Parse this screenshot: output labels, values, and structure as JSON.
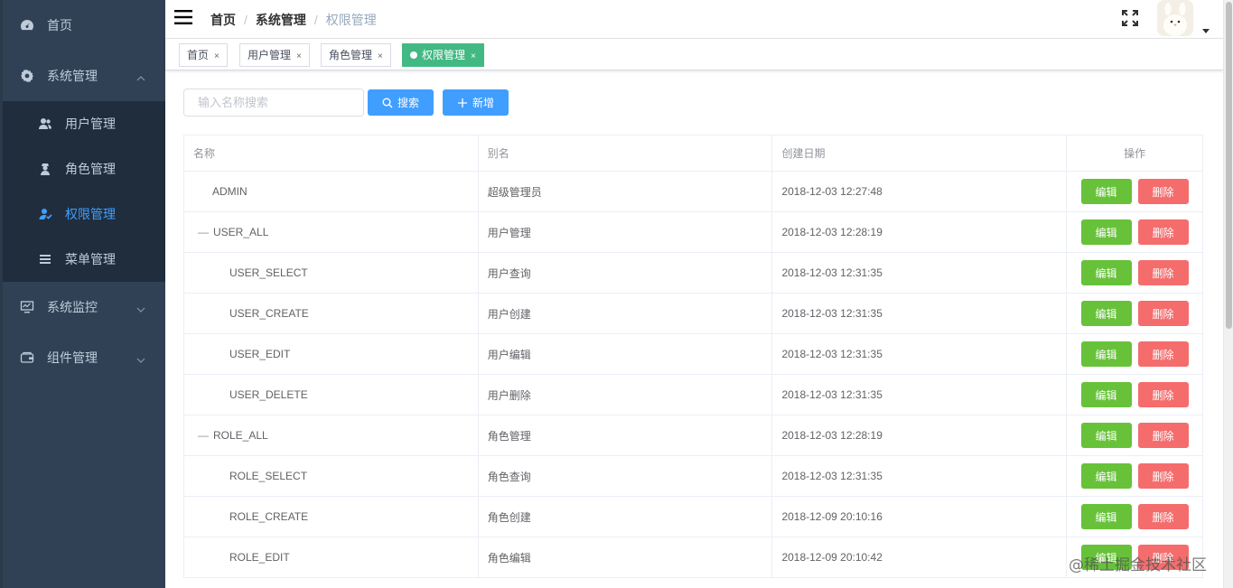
{
  "sidebar": {
    "items": [
      {
        "label": "首页",
        "icon": "dashboard-icon"
      },
      {
        "label": "系统管理",
        "icon": "gear-icon",
        "expanded": true,
        "children": [
          {
            "label": "用户管理",
            "icon": "user-icon"
          },
          {
            "label": "角色管理",
            "icon": "role-icon"
          },
          {
            "label": "权限管理",
            "icon": "permission-icon",
            "active": true
          },
          {
            "label": "菜单管理",
            "icon": "menu-icon"
          }
        ]
      },
      {
        "label": "系统监控",
        "icon": "monitor-icon"
      },
      {
        "label": "组件管理",
        "icon": "component-icon"
      }
    ]
  },
  "navbar": {
    "breadcrumb": [
      "首页",
      "系统管理",
      "权限管理"
    ]
  },
  "tags": [
    {
      "label": "首页"
    },
    {
      "label": "用户管理"
    },
    {
      "label": "角色管理"
    },
    {
      "label": "权限管理",
      "active": true
    }
  ],
  "toolbar": {
    "search_placeholder": "输入名称搜索",
    "search_label": "搜索",
    "add_label": "新增"
  },
  "table": {
    "columns": [
      "名称",
      "别名",
      "创建日期",
      "操作"
    ],
    "edit_label": "编辑",
    "delete_label": "删除",
    "rows": [
      {
        "name": "ADMIN",
        "alias": "超级管理员",
        "date": "2018-12-03 12:27:48",
        "level": 0,
        "expandable": false
      },
      {
        "name": "USER_ALL",
        "alias": "用户管理",
        "date": "2018-12-03 12:28:19",
        "level": 0,
        "expandable": true
      },
      {
        "name": "USER_SELECT",
        "alias": "用户查询",
        "date": "2018-12-03 12:31:35",
        "level": 1,
        "expandable": false
      },
      {
        "name": "USER_CREATE",
        "alias": "用户创建",
        "date": "2018-12-03 12:31:35",
        "level": 1,
        "expandable": false
      },
      {
        "name": "USER_EDIT",
        "alias": "用户编辑",
        "date": "2018-12-03 12:31:35",
        "level": 1,
        "expandable": false
      },
      {
        "name": "USER_DELETE",
        "alias": "用户删除",
        "date": "2018-12-03 12:31:35",
        "level": 1,
        "expandable": false
      },
      {
        "name": "ROLE_ALL",
        "alias": "角色管理",
        "date": "2018-12-03 12:28:19",
        "level": 0,
        "expandable": true
      },
      {
        "name": "ROLE_SELECT",
        "alias": "角色查询",
        "date": "2018-12-03 12:31:35",
        "level": 1,
        "expandable": false
      },
      {
        "name": "ROLE_CREATE",
        "alias": "角色创建",
        "date": "2018-12-09 20:10:16",
        "level": 1,
        "expandable": false
      },
      {
        "name": "ROLE_EDIT",
        "alias": "角色编辑",
        "date": "2018-12-09 20:10:42",
        "level": 1,
        "expandable": false
      }
    ]
  },
  "watermark": "@稀土掘金技术社区",
  "colors": {
    "sidebar_bg": "#304156",
    "submenu_bg": "#1f2d3d",
    "active_text": "#409eff",
    "active_tag": "#42b983",
    "primary": "#409eff",
    "success": "#67c23a",
    "danger": "#f56c6c"
  }
}
